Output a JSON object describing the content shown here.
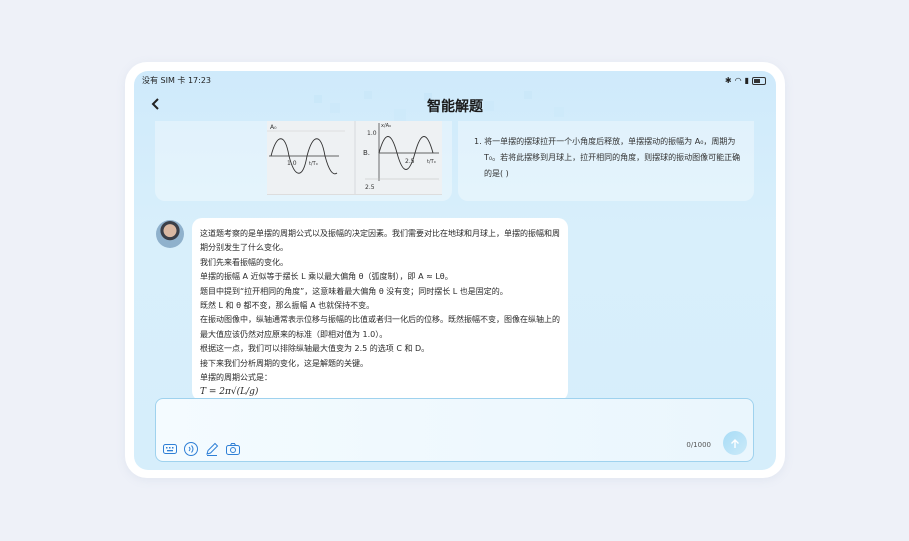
{
  "status_bar": {
    "left_text": "没有 SIM 卡 17:23"
  },
  "header": {
    "title": "智能解题"
  },
  "question": {
    "text": "1. 将一单摆的摆球拉开一个小角度后释放，单摆摆动的振幅为 A₀，周期为 T₀。若将此摆移到月球上，拉开相同的角度，则摆球的振动图像可能正确的是( )",
    "graph": {
      "label_left_tick": "1.0",
      "label_B": "B.",
      "label_B_y": "1.0",
      "label_B_tick": "2.5",
      "label_bottom": "2.5",
      "axis_t": "t/T₀",
      "axis_x": "x/A₀",
      "axis_a": "A₀"
    }
  },
  "answer": {
    "lines": [
      "这道题考察的是单摆的周期公式以及振幅的决定因素。我们需要对比在地球和月球上，单摆的振幅和周期分别发生了什么变化。",
      "我们先来看振幅的变化。",
      "单摆的振幅 A 近似等于摆长 L 乘以最大偏角 θ（弧度制），即 A ≈ Lθ。",
      "题目中提到“拉开相同的角度”，这意味着最大偏角 θ 没有变；同时摆长 L 也是固定的。",
      "既然 L 和 θ 都不变，那么振幅 A 也就保持不变。",
      "在振动图像中，纵轴通常表示位移与振幅的比值或者归一化后的位移。既然振幅不变，图像在纵轴上的最大值应该仍然对应原来的标准（即相对值为 1.0）。",
      "根据这一点，我们可以排除纵轴最大值变为 2.5 的选项 C 和 D。",
      "接下来我们分析周期的变化，这是解题的关键。",
      "单摆的周期公式是：",
      "T = 2π√(L/g)"
    ]
  },
  "input": {
    "placeholder": "",
    "counter": "0/1000"
  },
  "colors": {
    "accent": "#2f7fd6",
    "border": "#9fd2ee"
  }
}
